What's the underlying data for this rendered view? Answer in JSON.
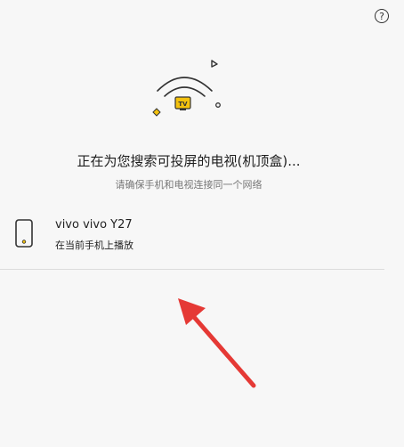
{
  "help": {
    "glyph": "?"
  },
  "illustration": {
    "badge_text": "TV",
    "accent_color": "#f4c20d"
  },
  "search": {
    "title": "正在为您搜索可投屏的电视(机顶盒)...",
    "subtitle": "请确保手机和电视连接同一个网络"
  },
  "devices": [
    {
      "name": "vivo  vivo Y27",
      "status": "在当前手机上播放",
      "icon": "phone-icon"
    }
  ],
  "annotation": {
    "arrow_color": "#e53935"
  }
}
